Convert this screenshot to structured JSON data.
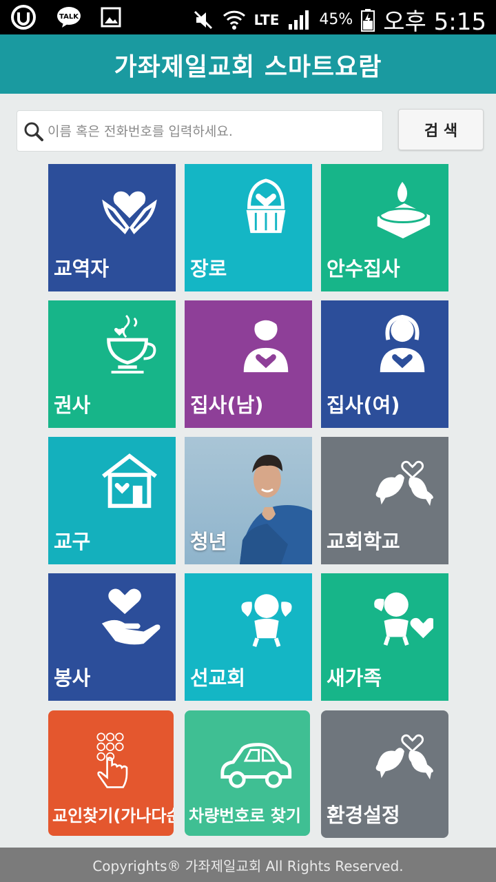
{
  "status_bar": {
    "talk_label": "TALK",
    "network": "LTE",
    "battery": "45%",
    "time": "오후 5:15"
  },
  "app": {
    "title": "가좌제일교회 스마트요람"
  },
  "search": {
    "placeholder": "이름 혹은 전화번호를 입력하세요.",
    "value": "",
    "button_label": "검 색"
  },
  "tiles": [
    {
      "label": "교역자",
      "color": "#2c4e9a",
      "icon": "heart-hands-icon"
    },
    {
      "label": "장로",
      "color": "#14b6c5",
      "icon": "cupcake-icon"
    },
    {
      "label": "안수집사",
      "color": "#17b589",
      "icon": "candle-icon"
    },
    {
      "label": "권사",
      "color": "#17b589",
      "icon": "coffee-cup-icon"
    },
    {
      "label": "집사(남)",
      "color": "#8e3f98",
      "icon": "man-heart-icon"
    },
    {
      "label": "집사(여)",
      "color": "#2c4e9a",
      "icon": "woman-heart-icon"
    },
    {
      "label": "교구",
      "color": "#14b0bd",
      "icon": "house-heart-icon"
    },
    {
      "label": "청년",
      "color": "#9bbdd2",
      "icon": "young-man-photo"
    },
    {
      "label": "교회학교",
      "color": "#6f767d",
      "icon": "love-birds-icon"
    },
    {
      "label": "봉사",
      "color": "#2c4e9a",
      "icon": "hand-heart-icon"
    },
    {
      "label": "선교회",
      "color": "#14b6c5",
      "icon": "angel-icon"
    },
    {
      "label": "새가족",
      "color": "#17b589",
      "icon": "cupid-heart-icon"
    },
    {
      "label": "교인찾기(가나다순)",
      "color": "#e4572e",
      "icon": "finger-touch-icon"
    },
    {
      "label": "차량번호로 찾기",
      "color": "#3fbf93",
      "icon": "car-icon"
    },
    {
      "label": "환경설정",
      "color": "#6f767d",
      "icon": "love-birds-icon"
    }
  ],
  "footer": {
    "text": "Copyrights® 가좌제일교회 All Rights Reserved."
  }
}
